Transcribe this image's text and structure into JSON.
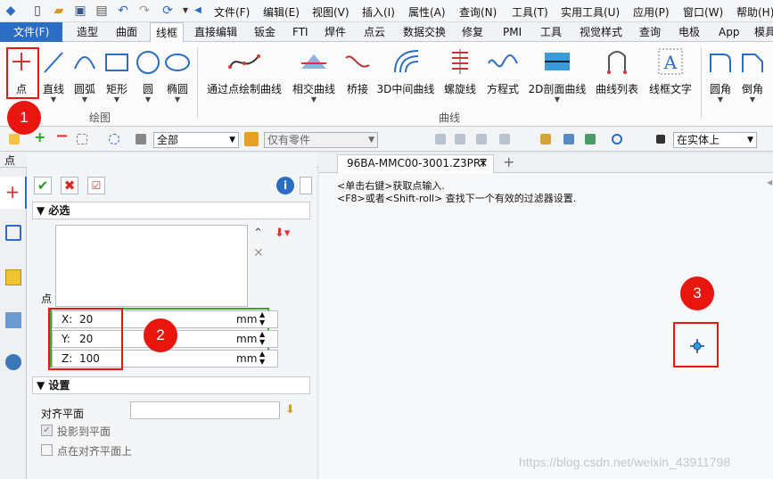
{
  "menu": {
    "items": [
      "文件(F)",
      "编辑(E)",
      "视图(V)",
      "插入(I)",
      "属性(A)",
      "查询(N)",
      "工具(T)",
      "实用工具(U)",
      "应用(P)",
      "窗口(W)",
      "帮助(H)"
    ]
  },
  "tabs": [
    "文件(F)",
    "造型",
    "曲面",
    "线框",
    "直接编辑",
    "钣金",
    "FTI",
    "焊件",
    "点云",
    "数据交换",
    "修复",
    "PMI",
    "工具",
    "视觉样式",
    "查询",
    "电极",
    "App",
    "模具"
  ],
  "ribbon": {
    "draw_buttons": [
      "点",
      "直线",
      "圆弧",
      "矩形",
      "圆",
      "椭圆"
    ],
    "draw_group": "绘图",
    "curve_buttons": [
      "通过点绘制曲线",
      "相交曲线",
      "桥接",
      "3D中间曲线",
      "螺旋线",
      "方程式",
      "2D剖面曲线",
      "曲线列表",
      "线框文字"
    ],
    "curve_group": "曲线",
    "edit_buttons": [
      "圆角",
      "倒角"
    ]
  },
  "toolbar": {
    "filter_value": "全部",
    "filter2_value": "仅有零件",
    "pick_value": "在实体上"
  },
  "panel": {
    "title": "点",
    "required_label": "必选",
    "point_label": "点",
    "coords": [
      {
        "axis": "X:",
        "value": "20",
        "unit": "mm"
      },
      {
        "axis": "Y:",
        "value": "20",
        "unit": "mm"
      },
      {
        "axis": "Z:",
        "value": "100",
        "unit": "mm"
      }
    ],
    "settings_label": "设置",
    "align_plane_label": "对齐平面",
    "project_label": "投影到平面",
    "on_plane_label": "点在对齐平面上"
  },
  "doc": {
    "tab_title": "96BA-MMC00-3001.Z3PRT",
    "hint1": "<单击右键>获取点输入.",
    "hint2": "<F8>或者<Shift-roll> 查找下一个有效的过滤器设置."
  },
  "annotations": {
    "badge1": "1",
    "badge2": "2",
    "badge3": "3"
  },
  "watermark": "https://blog.csdn.net/weixin_43911798",
  "colors": {
    "accent": "#2b6cc4",
    "annotation_red": "#e8160f",
    "coord_box_green": "#3aa832"
  }
}
